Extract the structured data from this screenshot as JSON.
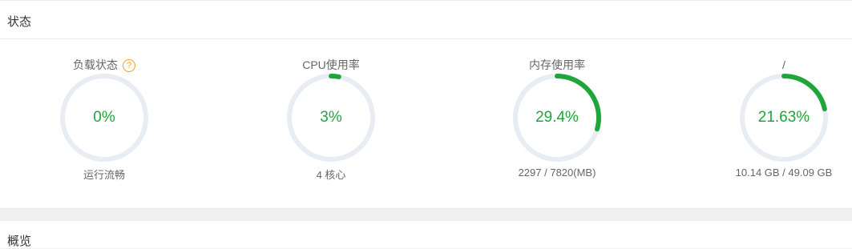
{
  "sections": {
    "status_title": "状态",
    "overview_title": "概览"
  },
  "colors": {
    "accent": "#20a53a",
    "track": "#e8ecf3",
    "help": "#f0a020"
  },
  "metrics": [
    {
      "label": "负载状态",
      "value": "0%",
      "percent": 0,
      "sub": "运行流畅",
      "help_icon": "question-circle-icon",
      "help_glyph": "?"
    },
    {
      "label": "CPU使用率",
      "value": "3%",
      "percent": 3,
      "sub": "4 核心"
    },
    {
      "label": "内存使用率",
      "value": "29.4%",
      "percent": 29.4,
      "sub": "2297 / 7820(MB)"
    },
    {
      "label": "/",
      "value": "21.63%",
      "percent": 21.63,
      "sub": "10.14 GB / 49.09 GB"
    }
  ]
}
